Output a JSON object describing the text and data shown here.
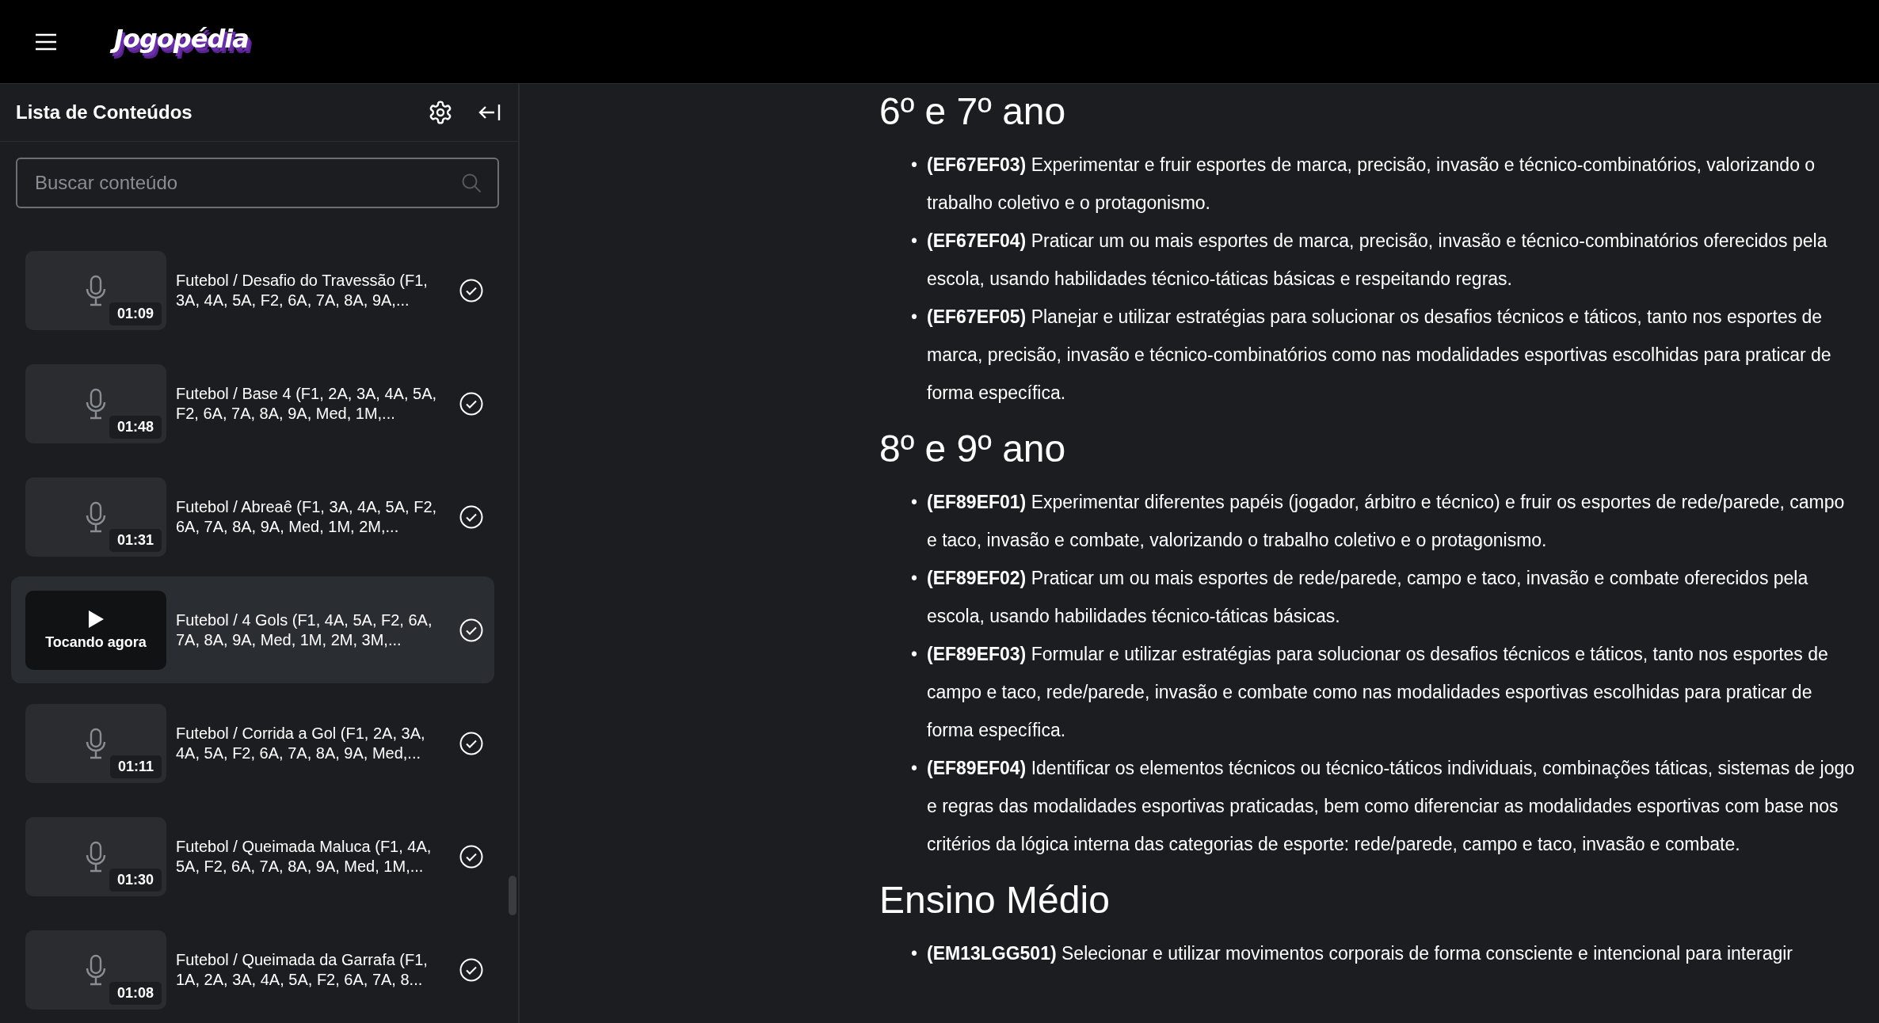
{
  "header": {
    "logo": "Jogopédia"
  },
  "sidebar": {
    "title": "Lista de Conteúdos",
    "search": {
      "placeholder": "Buscar conteúdo"
    },
    "items": [
      {
        "title": "Futebol / Desafio do Travessão (F1, 3A, 4A, 5A, F2, 6A, 7A, 8A, 9A,...",
        "duration": "01:09",
        "selected": false,
        "completed": true
      },
      {
        "title": "Futebol / Base 4 (F1, 2A, 3A, 4A, 5A, F2, 6A, 7A, 8A, 9A, Med, 1M,...",
        "duration": "01:48",
        "selected": false,
        "completed": true
      },
      {
        "title": "Futebol / Abreaê (F1, 3A, 4A, 5A, F2, 6A, 7A, 8A, 9A, Med, 1M, 2M,...",
        "duration": "01:31",
        "selected": false,
        "completed": true
      },
      {
        "title": "Futebol / 4 Gols (F1, 4A, 5A, F2, 6A, 7A, 8A, 9A, Med, 1M, 2M, 3M,...",
        "status": "Tocando agora",
        "selected": true,
        "completed": true
      },
      {
        "title": "Futebol / Corrida a Gol (F1, 2A, 3A, 4A, 5A, F2, 6A, 7A, 8A, 9A, Med,...",
        "duration": "01:11",
        "selected": false,
        "completed": true
      },
      {
        "title": "Futebol / Queimada Maluca (F1, 4A, 5A, F2, 6A, 7A, 8A, 9A, Med, 1M,...",
        "duration": "01:30",
        "selected": false,
        "completed": true
      },
      {
        "title": "Futebol / Queimada da Garrafa (F1, 1A, 2A, 3A, 4A, 5A, F2, 6A, 7A, 8...",
        "duration": "01:08",
        "selected": false,
        "completed": true
      }
    ]
  },
  "content": {
    "marker": "•",
    "sections": [
      {
        "heading": "6º e 7º ano",
        "bullets": [
          "**(EF67EF03)** Experimentar e fruir esportes de marca, precisão, invasão e técnico-combinatórios, valorizando o trabalho coletivo e o protagonismo.",
          "**(EF67EF04)** Praticar um ou mais esportes de marca, precisão, invasão e técnico-combinatórios oferecidos pela escola, usando habilidades técnico-táticas básicas e respeitando regras.",
          "**(EF67EF05)** Planejar e utilizar estratégias para solucionar os desafios técnicos e táticos, tanto nos esportes de marca, precisão, invasão e técnico-combinatórios como nas modalidades esportivas escolhidas para praticar de forma específica."
        ]
      },
      {
        "heading": "8º e 9º ano",
        "bullets": [
          "**(EF89EF01)** Experimentar diferentes papéis (jogador, árbitro e técnico) e fruir os esportes de rede/parede, campo e taco, invasão e combate, valorizando o trabalho coletivo e o protagonismo.",
          "**(EF89EF02)** Praticar um ou mais esportes de rede/parede, campo e taco, invasão e combate oferecidos pela escola, usando habilidades técnico-táticas básicas.",
          "**(EF89EF03)** Formular e utilizar estratégias para solucionar os desafios técnicos e táticos, tanto nos esportes de campo e taco, rede/parede, invasão e combate como nas modalidades esportivas escolhidas para praticar de forma específica.",
          "**(EF89EF04)** Identificar os elementos técnicos ou técnico-táticos individuais, combinações táticas, sistemas de jogo e regras das modalidades esportivas praticadas, bem como diferenciar as modalidades esportivas com base nos critérios da lógica interna das categorias de esporte: rede/parede, campo e taco, invasão e combate."
        ]
      },
      {
        "heading": "Ensino Médio",
        "bullets": [
          "**(EM13LGG501)** Selecionar e utilizar movimentos corporais de forma consciente e intencional para interagir"
        ]
      }
    ]
  }
}
